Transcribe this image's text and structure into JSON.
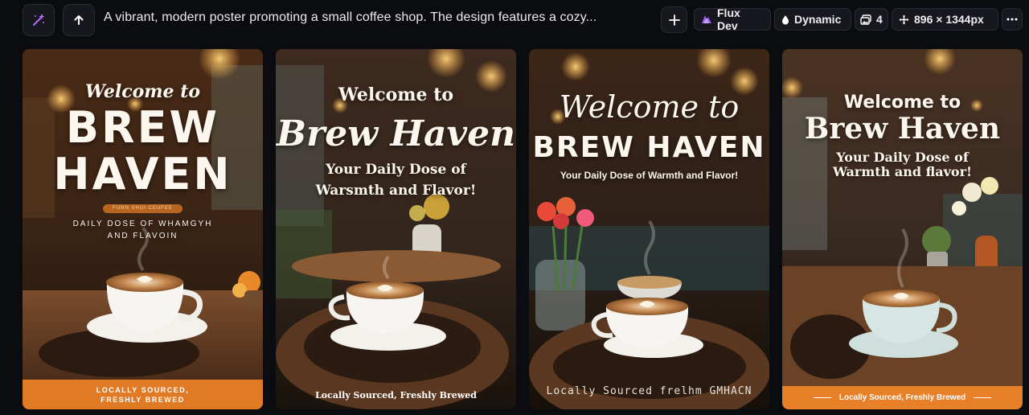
{
  "toolbar": {
    "prompt": "A vibrant, modern poster promoting a small coffee shop. The design features a cozy...",
    "model": "Flux Dev",
    "style": "Dynamic",
    "count": "4",
    "size": "896 × 1344px",
    "icons": [
      "magic-wand-icon",
      "arrow-up-icon",
      "plus-icon",
      "flux-logo-icon",
      "drop-icon",
      "images-icon",
      "move-icon",
      "more-icon"
    ],
    "accent": "#b06bf7"
  },
  "cards": [
    {
      "welcome": "Welcome to",
      "name_line1": "BREW",
      "name_line2": "HAVEN",
      "ribbon": "FUNN VHUI CEUFEE",
      "tagline_line1": "DAILY DOSE OF WHAMGYH",
      "tagline_line2": "AND FLAVOIN",
      "footer_line1": "LOCALLY SOURCED,",
      "footer_line2": "FRESHLY BREWED",
      "footer_color": "#e07a24"
    },
    {
      "welcome": "Welcome to",
      "name": "Brew Haven",
      "tagline_line1": "Your Daily Dose of",
      "tagline_line2": "Warsmth and Flavor!",
      "footer": "Locally Sourced, Freshly Brewed"
    },
    {
      "welcome": "Welcome to",
      "name": "BREW HAVEN",
      "tagline": "Your Daily Dose of Warmth and Flavor!",
      "footer": "Locally Sourced frelhm GMHACN"
    },
    {
      "welcome": "Welcome to",
      "name": "Brew Haven",
      "tagline_line1": "Your Daily Dose of",
      "tagline_line2": "Warmth and flavor!",
      "footer": "Locally Sourced, Freshly Brewed",
      "footer_color": "#e8802a"
    }
  ]
}
